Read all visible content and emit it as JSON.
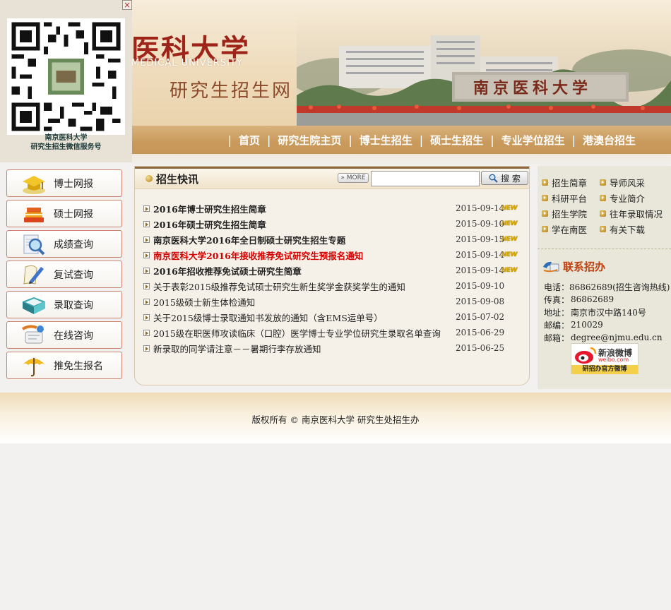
{
  "qr": {
    "caption_line1": "南京医科大学",
    "caption_line2": "研究生招生微信服务号",
    "close_glyph": "×"
  },
  "banner": {
    "school_name": "医科大学",
    "school_en": "MEDICAL UNIVERSITY",
    "site_name": "研究生招生网",
    "gate_text": "南京医科大学"
  },
  "nav": {
    "separator": "|",
    "items": [
      "首页",
      "研究生院主页",
      "博士生招生",
      "硕士生招生",
      "专业学位招生",
      "港澳台招生"
    ]
  },
  "left_menu": [
    {
      "label": "博士网报",
      "icon": "graduation-cap-icon"
    },
    {
      "label": "硕士网报",
      "icon": "books-icon"
    },
    {
      "label": "成绩查询",
      "icon": "magnifier-icon"
    },
    {
      "label": "复试查询",
      "icon": "pen-paper-icon"
    },
    {
      "label": "录取查询",
      "icon": "open-book-icon"
    },
    {
      "label": "在线咨询",
      "icon": "chat-icon"
    },
    {
      "label": "推免生报名",
      "icon": "umbrella-icon"
    }
  ],
  "news": {
    "title": "招生快讯",
    "more_label": "» MORE",
    "search_placeholder": "",
    "search_label": "搜 索",
    "new_tag": "NEW",
    "items": [
      {
        "title": "2016年博士研究生招生简章",
        "date": "2015-09-14",
        "bold": true,
        "red": false,
        "is_new": true
      },
      {
        "title": "2016年硕士研究生招生简章",
        "date": "2015-09-10",
        "bold": true,
        "red": false,
        "is_new": true
      },
      {
        "title": "南京医科大学2016年全日制硕士研究生招生专题",
        "date": "2015-09-15",
        "bold": true,
        "red": false,
        "is_new": true
      },
      {
        "title": "南京医科大学2016年接收推荐免试研究生预报名通知",
        "date": "2015-09-14",
        "bold": true,
        "red": true,
        "is_new": true
      },
      {
        "title": "2016年招收推荐免试硕士研究生简章",
        "date": "2015-09-14",
        "bold": true,
        "red": false,
        "is_new": true
      },
      {
        "title": "关于表彰2015级推荐免试硕士研究生新生奖学金获奖学生的通知",
        "date": "2015-09-10",
        "bold": false,
        "red": false,
        "is_new": false
      },
      {
        "title": "2015级硕士新生体检通知",
        "date": "2015-09-08",
        "bold": false,
        "red": false,
        "is_new": false
      },
      {
        "title": "关于2015级博士录取通知书发放的通知（含EMS运单号）",
        "date": "2015-07-02",
        "bold": false,
        "red": false,
        "is_new": false
      },
      {
        "title": "2015级在职医师攻读临床（口腔）医学博士专业学位研究生录取名单查询",
        "date": "2015-06-29",
        "bold": false,
        "red": false,
        "is_new": false
      },
      {
        "title": "新录取的同学请注意－－暑期行李存放通知",
        "date": "2015-06-25",
        "bold": false,
        "red": false,
        "is_new": false
      }
    ]
  },
  "quick_links": [
    "招生简章",
    "导师风采",
    "科研平台",
    "专业简介",
    "招生学院",
    "往年录取情况",
    "学在南医",
    "有关下载"
  ],
  "contact": {
    "title": "联系招办",
    "rows": [
      {
        "k": "电话：",
        "v": "86862689(招生咨询热线)"
      },
      {
        "k": "传真：",
        "v": "86862689"
      },
      {
        "k": "地址：",
        "v": "南京市汉中路140号"
      },
      {
        "k": "邮编：",
        "v": "210029"
      },
      {
        "k": "邮箱：",
        "v": "degree@njmu.edu.cn"
      }
    ],
    "weibo_name": "新浪微博",
    "weibo_domain": "weibo.com",
    "weibo_caption": "研招办官方微博"
  },
  "footer": {
    "copyright": "版权所有 © 南京医科大学 研究生处招生办"
  },
  "colors": {
    "accent_red": "#d40000",
    "nav_bg": "#c99a5c",
    "menu_border": "#c9826e"
  }
}
